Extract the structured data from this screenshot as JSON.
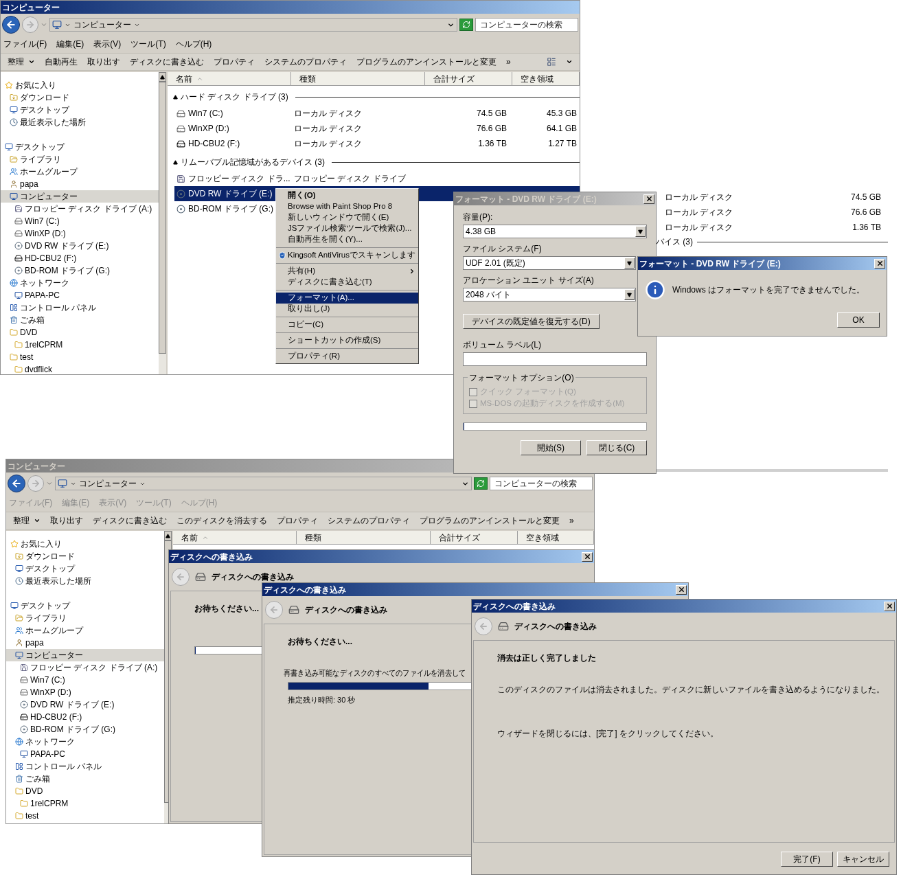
{
  "explorers": [
    {
      "title": "コンピューター",
      "active": true,
      "address": "コンピューター",
      "search": {
        "placeholder": "コンピューターの検索"
      },
      "menu": {
        "disabled": false,
        "items": [
          "ファイル(F)",
          "編集(E)",
          "表示(V)",
          "ツール(T)",
          "ヘルプ(H)"
        ]
      },
      "commands": [
        {
          "label": "整理",
          "dropdown": true
        },
        {
          "label": "自動再生",
          "dropdown": false
        },
        {
          "label": "取り出す",
          "dropdown": false
        },
        {
          "label": "ディスクに書き込む",
          "dropdown": false
        },
        {
          "label": "プロパティ",
          "dropdown": false
        },
        {
          "label": "システムのプロパティ",
          "dropdown": false
        },
        {
          "label": "プログラムのアンインストールと変更",
          "dropdown": false
        },
        {
          "label": "»",
          "dropdown": false
        }
      ],
      "columns": [
        "名前",
        "種類",
        "合計サイズ",
        "空き領域"
      ],
      "nav": [
        {
          "label": "お気に入り",
          "kind": "star",
          "selected": false,
          "children": [
            {
              "label": "ダウンロード",
              "kind": "download",
              "selected": false
            },
            {
              "label": "デスクトップ",
              "kind": "desktop",
              "selected": false
            },
            {
              "label": "最近表示した場所",
              "kind": "recent",
              "selected": false
            }
          ]
        },
        {
          "label": "デスクトップ",
          "kind": "desktop",
          "selected": false,
          "children": [
            {
              "label": "ライブラリ",
              "kind": "library",
              "selected": false
            },
            {
              "label": "ホームグループ",
              "kind": "homegroup",
              "selected": false
            },
            {
              "label": "papa",
              "kind": "user",
              "selected": false
            },
            {
              "label": "コンピューター",
              "kind": "computer",
              "selected": true,
              "children": [
                {
                  "label": "フロッピー ディスク ドライブ (A:)",
                  "kind": "floppy",
                  "selected": false
                },
                {
                  "label": "Win7 (C:)",
                  "kind": "drive",
                  "selected": false
                },
                {
                  "label": "WinXP (D:)",
                  "kind": "drive",
                  "selected": false
                },
                {
                  "label": "DVD RW ドライブ (E:)",
                  "kind": "disc",
                  "selected": false
                },
                {
                  "label": "HD-CBU2 (F:)",
                  "kind": "external",
                  "selected": false
                },
                {
                  "label": "BD-ROM ドライブ (G:)",
                  "kind": "disc",
                  "selected": false
                }
              ]
            },
            {
              "label": "ネットワーク",
              "kind": "network",
              "selected": false,
              "children": [
                {
                  "label": "PAPA-PC",
                  "kind": "computer",
                  "selected": false
                }
              ]
            },
            {
              "label": "コントロール パネル",
              "kind": "panel",
              "selected": false
            },
            {
              "label": "ごみ箱",
              "kind": "trash",
              "selected": false
            },
            {
              "label": "DVD",
              "kind": "folder",
              "selected": false,
              "children": [
                {
                  "label": "1relCPRM",
                  "kind": "folder",
                  "selected": false
                }
              ]
            },
            {
              "label": "test",
              "kind": "folder",
              "selected": false,
              "children": [
                {
                  "label": "dvdflick",
                  "kind": "folder",
                  "selected": false
                }
              ]
            }
          ]
        }
      ],
      "groups": [
        {
          "label": "ハード ディスク ドライブ (3)",
          "rows": [
            {
              "name": "Win7 (C:)",
              "kind": "drive",
              "type": "ローカル ディスク",
              "total": "74.5 GB",
              "free": "45.3 GB",
              "selected": false
            },
            {
              "name": "WinXP (D:)",
              "kind": "drive",
              "type": "ローカル ディスク",
              "total": "76.6 GB",
              "free": "64.1 GB",
              "selected": false
            },
            {
              "name": "HD-CBU2 (F:)",
              "kind": "external",
              "type": "ローカル ディスク",
              "total": "1.36 TB",
              "free": "1.27 TB",
              "selected": false
            }
          ]
        },
        {
          "label": "リムーバブル記憶域があるデバイス (3)",
          "rows": [
            {
              "name": "フロッピー ディスク ドラ...",
              "kind": "floppy",
              "type": "フロッピー ディスク ドライブ",
              "selected": false
            },
            {
              "name": "DVD RW ドライブ (E:)",
              "kind": "disc",
              "selected": true
            },
            {
              "name": "BD-ROM ドライブ (G:)",
              "kind": "disc",
              "selected": false
            }
          ]
        }
      ]
    },
    {
      "title": "コンピューター",
      "active": false,
      "address": "コンピューター",
      "search": {
        "placeholder": "コンピューターの検索"
      },
      "menu": {
        "disabled": true,
        "items": [
          "ファイル(F)",
          "編集(E)",
          "表示(V)",
          "ツール(T)",
          "ヘルプ(H)"
        ]
      },
      "commands": [
        {
          "label": "整理",
          "dropdown": true
        },
        {
          "label": "取り出す",
          "dropdown": false
        },
        {
          "label": "ディスクに書き込む",
          "dropdown": false
        },
        {
          "label": "このディスクを消去する",
          "dropdown": false
        },
        {
          "label": "プロパティ",
          "dropdown": false
        },
        {
          "label": "システムのプロパティ",
          "dropdown": false
        },
        {
          "label": "プログラムのアンインストールと変更",
          "dropdown": false
        },
        {
          "label": "»",
          "dropdown": false
        }
      ],
      "columns": [
        "名前",
        "種類",
        "合計サイズ",
        "空き領域"
      ],
      "nav": [
        {
          "label": "お気に入り",
          "kind": "star",
          "selected": false,
          "children": [
            {
              "label": "ダウンロード",
              "kind": "download",
              "selected": false
            },
            {
              "label": "デスクトップ",
              "kind": "desktop",
              "selected": false
            },
            {
              "label": "最近表示した場所",
              "kind": "recent",
              "selected": false
            }
          ]
        },
        {
          "label": "デスクトップ",
          "kind": "desktop",
          "selected": false,
          "children": [
            {
              "label": "ライブラリ",
              "kind": "library",
              "selected": false
            },
            {
              "label": "ホームグループ",
              "kind": "homegroup",
              "selected": false
            },
            {
              "label": "papa",
              "kind": "user",
              "selected": false
            },
            {
              "label": "コンピューター",
              "kind": "computer",
              "selected": true,
              "children": [
                {
                  "label": "フロッピー ディスク ドライブ (A:)",
                  "kind": "floppy",
                  "selected": false
                },
                {
                  "label": "Win7 (C:)",
                  "kind": "drive",
                  "selected": false
                },
                {
                  "label": "WinXP (D:)",
                  "kind": "drive",
                  "selected": false
                },
                {
                  "label": "DVD RW ドライブ (E:)",
                  "kind": "disc",
                  "selected": false
                },
                {
                  "label": "HD-CBU2 (F:)",
                  "kind": "external",
                  "selected": false
                },
                {
                  "label": "BD-ROM ドライブ (G:)",
                  "kind": "disc",
                  "selected": false
                }
              ]
            },
            {
              "label": "ネットワーク",
              "kind": "network",
              "selected": false,
              "children": [
                {
                  "label": "PAPA-PC",
                  "kind": "computer",
                  "selected": false
                }
              ]
            },
            {
              "label": "コントロール パネル",
              "kind": "panel",
              "selected": false
            },
            {
              "label": "ごみ箱",
              "kind": "trash",
              "selected": false
            },
            {
              "label": "DVD",
              "kind": "folder",
              "selected": false,
              "children": [
                {
                  "label": "1relCPRM",
                  "kind": "folder",
                  "selected": false
                }
              ]
            },
            {
              "label": "test",
              "kind": "folder",
              "selected": false
            }
          ]
        }
      ]
    }
  ],
  "explorer_fragment": {
    "rows": [
      {
        "type": "ローカル ディスク",
        "total": "74.5 GB"
      },
      {
        "type": "ローカル ディスク",
        "total": "76.6 GB"
      },
      {
        "type": "ローカル ディスク",
        "total": "1.36 TB"
      }
    ],
    "group_label": "バイス (3)"
  },
  "context_menu": {
    "sections": [
      [
        {
          "label": "開く(O)",
          "kind": "plain",
          "default": true,
          "submenu": false,
          "selected": false
        },
        {
          "label": "Browse with Paint Shop Pro 8",
          "kind": "plain",
          "default": false,
          "submenu": false,
          "selected": false
        },
        {
          "label": "新しいウィンドウで開く(E)",
          "kind": "plain",
          "default": false,
          "submenu": false,
          "selected": false
        },
        {
          "label": "JSファイル検索ツールで検索(J)...",
          "kind": "plain",
          "default": false,
          "submenu": false,
          "selected": false
        },
        {
          "label": "自動再生を開く(Y)...",
          "kind": "plain",
          "default": false,
          "submenu": false,
          "selected": false
        }
      ],
      [
        {
          "label": "Kingsoft AntiVirusでスキャンします",
          "kind": "app",
          "default": false,
          "submenu": false,
          "selected": false
        }
      ],
      [
        {
          "label": "共有(H)",
          "kind": "plain",
          "default": false,
          "submenu": true,
          "selected": false
        },
        {
          "label": "ディスクに書き込む(T)",
          "kind": "plain",
          "default": false,
          "submenu": false,
          "selected": false
        }
      ],
      [
        {
          "label": "フォーマット(A)...",
          "kind": "plain",
          "default": false,
          "submenu": false,
          "selected": true
        },
        {
          "label": "取り出し(J)",
          "kind": "plain",
          "default": false,
          "submenu": false,
          "selected": false
        }
      ],
      [
        {
          "label": "コピー(C)",
          "kind": "plain",
          "default": false,
          "submenu": false,
          "selected": false
        }
      ],
      [
        {
          "label": "ショートカットの作成(S)",
          "kind": "plain",
          "default": false,
          "submenu": false,
          "selected": false
        }
      ],
      [
        {
          "label": "プロパティ(R)",
          "kind": "plain",
          "default": false,
          "submenu": false,
          "selected": false
        }
      ]
    ]
  },
  "format_dialog": {
    "title": "フォーマット - DVD RW ドライブ (E:)",
    "active": false,
    "fields": [
      {
        "label": "容量(P):",
        "value": "4.38 GB"
      },
      {
        "label": "ファイル システム(F)",
        "value": "UDF 2.01 (既定)"
      },
      {
        "label": "アロケーション ユニット サイズ(A)",
        "value": "2048 バイト"
      }
    ],
    "restore_button": "デバイスの既定値を復元する(D)",
    "volume_label": {
      "label": "ボリューム ラベル(L)"
    },
    "options": {
      "label": "フォーマット オプション(O)",
      "items": [
        {
          "label": "クイック フォーマット(Q)",
          "checked": false,
          "disabled": true
        },
        {
          "label": "MS-DOS の起動ディスクを作成する(M)",
          "checked": false,
          "disabled": true
        }
      ]
    },
    "progress": {
      "level": 0
    },
    "buttons": [
      "開始(S)",
      "閉じる(C)"
    ]
  },
  "message_box": {
    "title": "フォーマット - DVD RW ドライブ (E:)",
    "active": true,
    "message": "Windows はフォーマットを完了できませんでした。",
    "button": "OK"
  },
  "wizards": [
    {
      "title": "ディスクへの書き込み",
      "active": true,
      "header": "ディスクへの書き込み",
      "heading": "お待ちください...",
      "kind": "progress",
      "progress": {
        "level": 0
      }
    },
    {
      "title": "ディスクへの書き込み",
      "active": true,
      "header": "ディスクへの書き込み",
      "heading": "お待ちください...",
      "paragraphs": [
        "再書き込み可能なディスクのすべてのファイルを消去して"
      ],
      "kind": "progress",
      "progress": {
        "level": 0.38
      },
      "remaining": "推定残り時間: 30 秒"
    },
    {
      "title": "ディスクへの書き込み",
      "active": true,
      "header": "ディスクへの書き込み",
      "heading": "消去は正しく完了しました",
      "kind": "done",
      "paragraphs": [
        "このディスクのファイルは消去されました。ディスクに新しいファイルを書き込めるようになりました。",
        "ウィザードを閉じるには、[完了] をクリックしてください。"
      ],
      "buttons": [
        "完了(F)",
        "キャンセル"
      ]
    }
  ]
}
